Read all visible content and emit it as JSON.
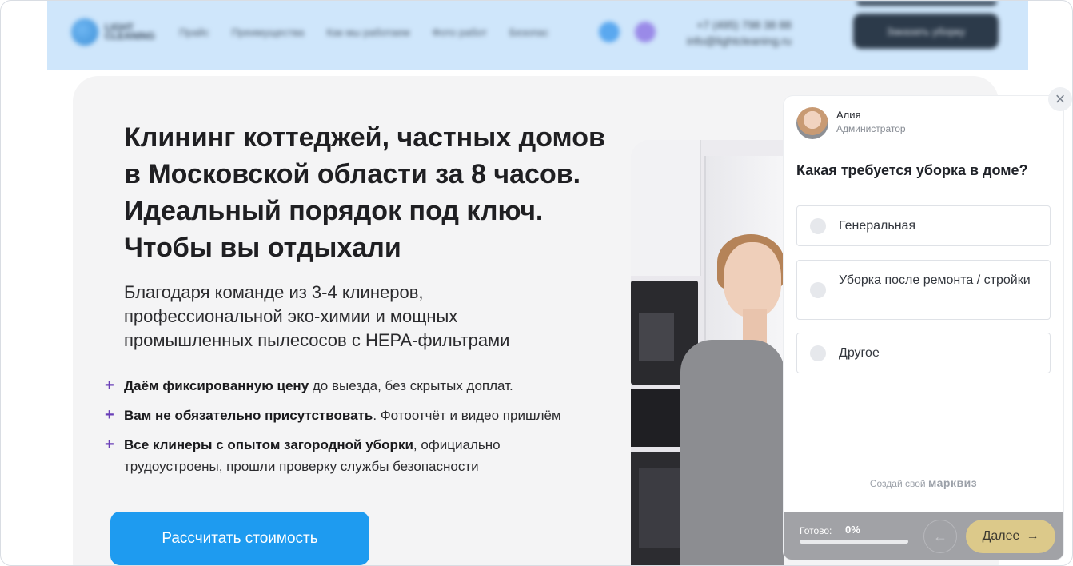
{
  "header": {
    "logo_text": "LIGHT CLEANING",
    "nav": [
      "Прайс",
      "Преимущества",
      "Как мы работаем",
      "Фото работ",
      "Безопас"
    ],
    "phone": "+7 (495) 798 38 88",
    "email": "info@lightcleaning.ru",
    "call_button": "Заказать уборку"
  },
  "hero": {
    "title": "Клининг коттеджей, частных домов в Московской области за 8 часов. Идеальный порядок под ключ. Чтобы вы отдыхали",
    "subtitle": "Благодаря команде из 3-4 клинеров, профессиональной эко-химии и мощных промышленных пылесосов с HEPA-фильтрами",
    "features": [
      {
        "bold": "Даём фиксированную цену",
        "rest": " до выезда, без скрытых доплат."
      },
      {
        "bold": "Вам не обязательно присутствовать",
        "rest": ". Фотоотчёт и видео пришлём"
      },
      {
        "bold": "Все клинеры с опытом загородной уборки",
        "rest": ", официально трудоустроены, прошли проверку службы безопасности"
      }
    ],
    "cta": "Рассчитать стоимость"
  },
  "quiz": {
    "admin_name": "Алия",
    "admin_role": "Администратор",
    "question": "Какая требуется уборка в доме?",
    "options": [
      "Генеральная",
      "Уборка после ремонта / стройки",
      "Другое"
    ],
    "powered_prefix": "Создай свой",
    "powered_brand": "марквиз",
    "progress_label": "Готово:",
    "progress_value": "0%",
    "progress_fraction": 0,
    "back_arrow": "←",
    "next_label": "Далее",
    "next_arrow": "→",
    "close": "×"
  },
  "colors": {
    "accent": "#1e9bf0",
    "plus": "#6a3fb8",
    "next": "#dcc98a"
  }
}
